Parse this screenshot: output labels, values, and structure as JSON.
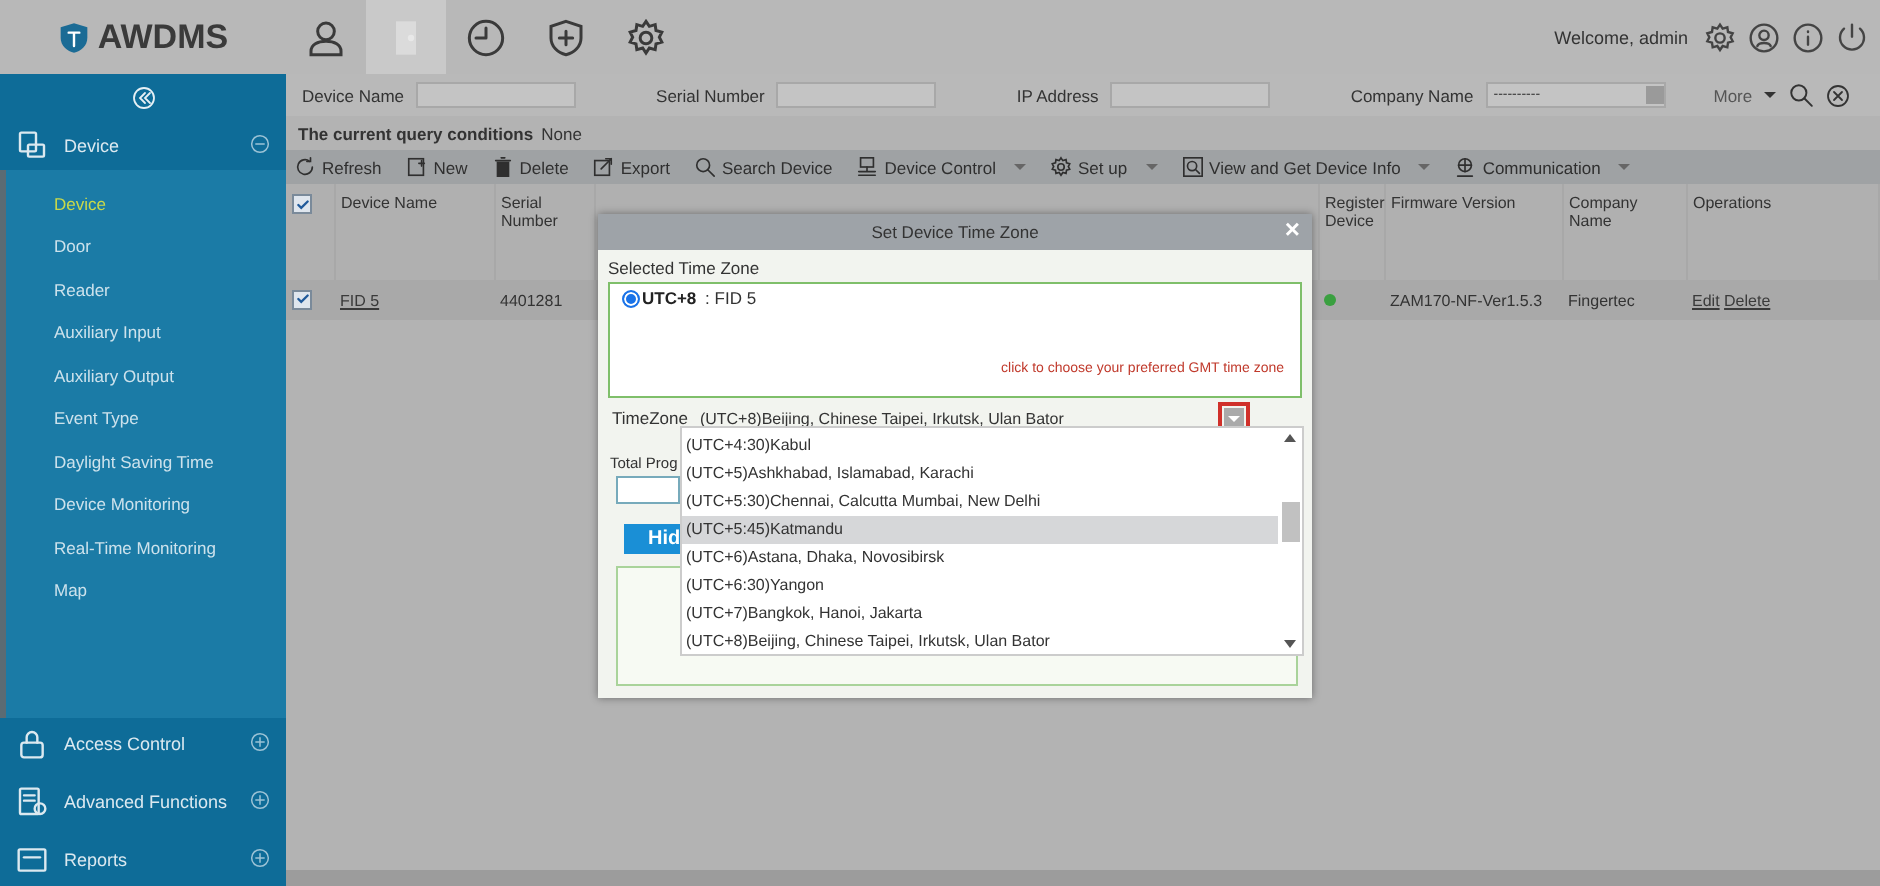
{
  "header": {
    "logo": "AWDMS",
    "modules": [
      {
        "kind": "person",
        "selected": false
      },
      {
        "kind": "door",
        "selected": true
      },
      {
        "kind": "clock",
        "selected": false
      },
      {
        "kind": "shield",
        "selected": false
      },
      {
        "kind": "gear",
        "selected": false
      }
    ],
    "welcome": "Welcome, admin",
    "actions": [
      {
        "kind": "gear"
      },
      {
        "kind": "user"
      },
      {
        "kind": "info"
      },
      {
        "kind": "power"
      }
    ]
  },
  "sidebar": {
    "groups": [
      {
        "label": "Device",
        "kind": "device",
        "expanded": true,
        "items": [
          {
            "label": "Device",
            "selected": true
          },
          {
            "label": "Door",
            "selected": false
          },
          {
            "label": "Reader",
            "selected": false
          },
          {
            "label": "Auxiliary Input",
            "selected": false
          },
          {
            "label": "Auxiliary Output",
            "selected": false
          },
          {
            "label": "Event Type",
            "selected": false
          },
          {
            "label": "Daylight Saving Time",
            "selected": false
          },
          {
            "label": "Device Monitoring",
            "selected": false
          },
          {
            "label": "Real-Time Monitoring",
            "selected": false
          },
          {
            "label": "Map",
            "selected": false
          }
        ]
      },
      {
        "label": "Access Control",
        "kind": "lock",
        "expanded": false
      },
      {
        "label": "Advanced Functions",
        "kind": "advanced",
        "expanded": false
      },
      {
        "label": "Reports",
        "kind": "report",
        "expanded": false
      }
    ]
  },
  "filters": [
    {
      "label": "Device Name",
      "kind": "text"
    },
    {
      "label": "Serial Number",
      "kind": "text"
    },
    {
      "label": "IP Address",
      "kind": "text"
    },
    {
      "label": "Company Name",
      "kind": "select",
      "value": "----------"
    }
  ],
  "more": "More",
  "query": {
    "label": "The current query conditions",
    "value": "None"
  },
  "toolbar": [
    {
      "label": "Refresh",
      "kind": "refresh",
      "dropdown": false
    },
    {
      "label": "New",
      "kind": "new",
      "dropdown": false
    },
    {
      "label": "Delete",
      "kind": "delete",
      "dropdown": false
    },
    {
      "label": "Export",
      "kind": "export",
      "dropdown": false
    },
    {
      "label": "Search Device",
      "kind": "search",
      "dropdown": false
    },
    {
      "label": "Device Control",
      "kind": "control",
      "dropdown": true
    },
    {
      "label": "Set up",
      "kind": "gear",
      "dropdown": true
    },
    {
      "label": "View and Get Device Info",
      "kind": "view",
      "dropdown": true
    },
    {
      "label": "Communication",
      "kind": "globe",
      "dropdown": true
    }
  ],
  "table": {
    "all_checked": true,
    "columns": [
      "Device Name",
      "Serial Number",
      "Register Device",
      "Firmware Version",
      "Company Name",
      "Operations"
    ],
    "rows": [
      {
        "checked": true,
        "device_name": "FID 5",
        "serial_number": "4401281",
        "registered": true,
        "firmware": "ZAM170-NF-Ver1.5.3",
        "company": "Fingertec",
        "operations": [
          "Edit",
          "Delete"
        ]
      }
    ]
  },
  "dialog": {
    "title": "Set Device Time Zone",
    "close": "×",
    "selected_label": "Selected Time Zone",
    "zones": [
      {
        "code": "UTC+8",
        "device": ": FID 5",
        "selected": true
      }
    ],
    "hint": "click to choose your preferred GMT time zone",
    "timezone_label": "TimeZone",
    "timezone_value": "(UTC+8)Beijing, Chinese Taipei, Irkutsk, Ulan Bator",
    "progress_label": "Total Prog",
    "hide_button": "Hid",
    "options": [
      {
        "label": "(UTC+4:30)Kabul",
        "selected": false
      },
      {
        "label": "(UTC+5)Ashkhabad, Islamabad, Karachi",
        "selected": false
      },
      {
        "label": "(UTC+5:30)Chennai, Calcutta Mumbai, New Delhi",
        "selected": false
      },
      {
        "label": "(UTC+5:45)Katmandu",
        "selected": true
      },
      {
        "label": "(UTC+6)Astana, Dhaka, Novosibirsk",
        "selected": false
      },
      {
        "label": "(UTC+6:30)Yangon",
        "selected": false
      },
      {
        "label": "(UTC+7)Bangkok, Hanoi, Jakarta",
        "selected": false
      },
      {
        "label": "(UTC+8)Beijing, Chinese Taipei, Irkutsk, Ulan Bator",
        "selected": false
      }
    ]
  }
}
